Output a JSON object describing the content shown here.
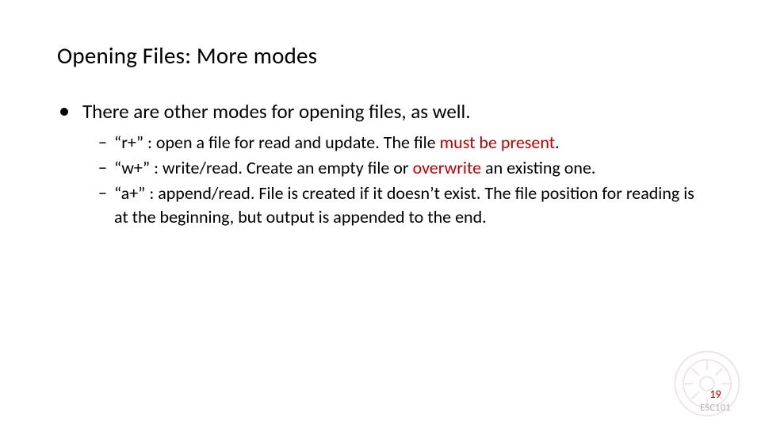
{
  "title": "Opening Files: More modes",
  "main_bullet": "There are other modes for opening files, as well.",
  "items": [
    {
      "pre": "“r+” : open a file for read and update. The file ",
      "emph": "must be present",
      "post": "."
    },
    {
      "pre": "“w+” : write/read. Create an empty file or ",
      "emph": "overwrite",
      "post": " an existing one."
    },
    {
      "pre": "“a+” : append/read. File is created if it doesn’t exist. The file position for reading is at the beginning, but output is appended to the end.",
      "emph": "",
      "post": ""
    }
  ],
  "page_number": "19",
  "course_code": "ESC101"
}
